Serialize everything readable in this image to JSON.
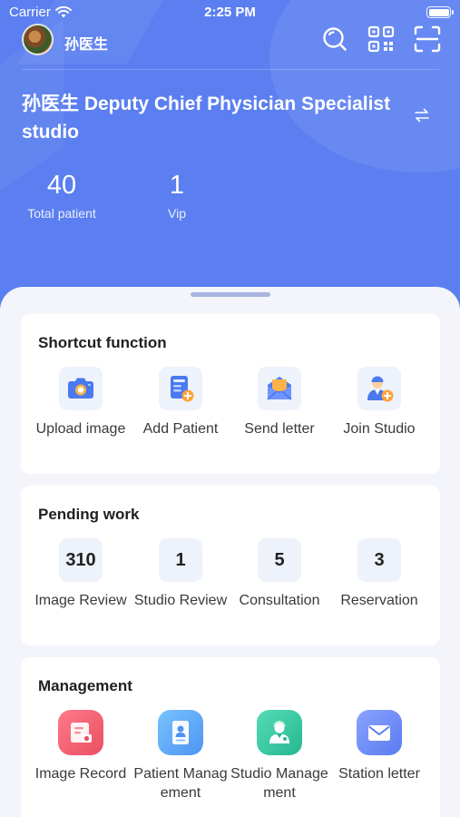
{
  "status_bar": {
    "carrier": "Carrier",
    "time": "2:25 PM"
  },
  "header": {
    "user_name": "孙医生",
    "studio_title": "孙医生 Deputy Chief Physician Specialist studio",
    "stats": [
      {
        "value": "40",
        "label": "Total patient"
      },
      {
        "value": "1",
        "label": "Vip"
      }
    ]
  },
  "shortcut": {
    "title": "Shortcut function",
    "items": [
      {
        "label": "Upload image",
        "icon": "camera-icon"
      },
      {
        "label": "Add Patient",
        "icon": "add-patient-icon"
      },
      {
        "label": "Send letter",
        "icon": "envelope-icon"
      },
      {
        "label": "Join Studio",
        "icon": "join-studio-icon"
      }
    ]
  },
  "pending": {
    "title": "Pending work",
    "items": [
      {
        "count": "310",
        "label": "Image Review"
      },
      {
        "count": "1",
        "label": "Studio Review"
      },
      {
        "count": "5",
        "label": "Consultation"
      },
      {
        "count": "3",
        "label": "Reservation"
      }
    ]
  },
  "management": {
    "title": "Management",
    "items": [
      {
        "label": "Image Record",
        "icon": "image-record-icon",
        "color": "#ea4f61"
      },
      {
        "label": "Patient Management",
        "icon": "patient-card-icon",
        "color": "#4f94f2"
      },
      {
        "label": "Studio Management",
        "icon": "studio-doctor-icon",
        "color": "#26b792"
      },
      {
        "label": "Station letter",
        "icon": "mail-icon",
        "color": "#5a7bf0"
      }
    ]
  },
  "colors": {
    "header_bg": "#5b7ff0",
    "page_bg": "#f3f5fb",
    "card_bg": "#ffffff",
    "accent_orange": "#f6a53c"
  }
}
